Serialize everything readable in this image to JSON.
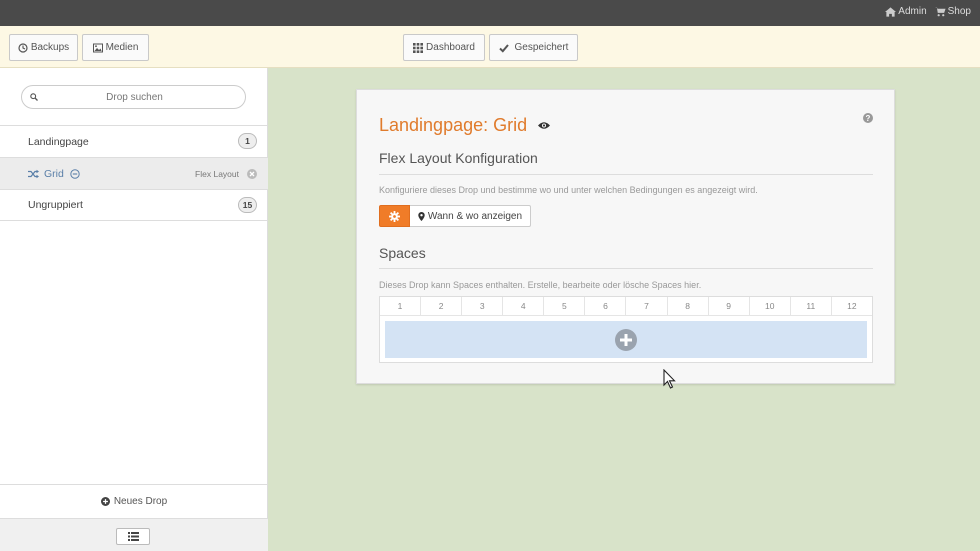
{
  "topbar": {
    "admin": "Admin",
    "shop": "Shop"
  },
  "toolbar": {
    "backups": "Backups",
    "medien": "Medien",
    "dashboard": "Dashboard",
    "gespeichert": "Gespeichert"
  },
  "sidebar": {
    "search_placeholder": "Drop suchen",
    "items": [
      {
        "label": "Landingpage",
        "count": "1"
      },
      {
        "label": "Grid",
        "tag": "Flex Layout"
      },
      {
        "label": "Ungruppiert",
        "count": "15"
      }
    ],
    "new_drop": "Neues Drop"
  },
  "panel": {
    "title": "Landingpage: Grid",
    "config_heading": "Flex Layout Konfiguration",
    "config_desc": "Konfiguriere dieses Drop und bestimme wo und unter welchen Bedingungen es angezeigt wird.",
    "wann_button": "Wann & wo anzeigen",
    "spaces_heading": "Spaces",
    "spaces_desc": "Dieses Drop kann Spaces enthalten. Erstelle, bearbeite oder lösche Spaces hier.",
    "columns": [
      "1",
      "2",
      "3",
      "4",
      "5",
      "6",
      "7",
      "8",
      "9",
      "10",
      "11",
      "12"
    ]
  },
  "colors": {
    "accent": "#f07c28",
    "title": "#e07b2c",
    "background": "#d8e3c9",
    "toolbar": "#fdf8e4",
    "dropzone": "#d4e3f4"
  }
}
